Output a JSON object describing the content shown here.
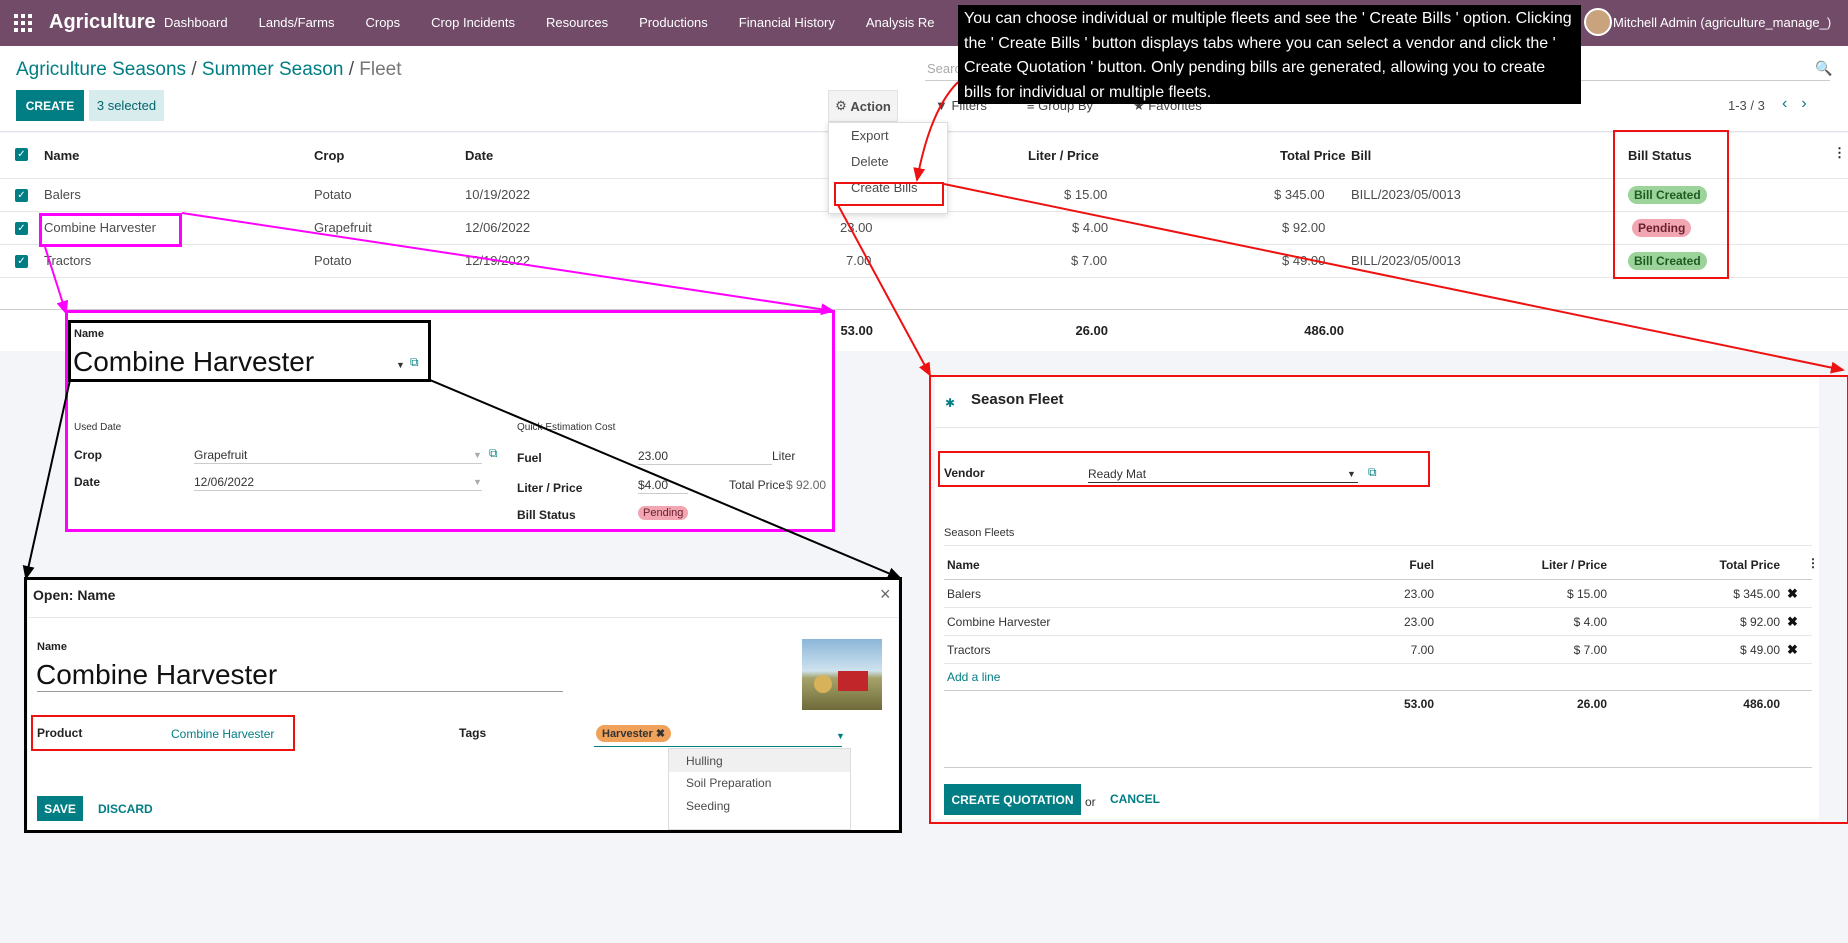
{
  "nav": {
    "brand": "Agriculture",
    "menu": [
      "Dashboard",
      "Lands/Farms",
      "Crops",
      "Crop Incidents",
      "Resources",
      "Productions",
      "Financial History",
      "Analysis Re"
    ],
    "user": "Mitchell Admin (agriculture_manage_)"
  },
  "breadcrumb": {
    "a": "Agriculture Seasons",
    "b": "Summer Season",
    "c": "Fleet",
    "sep": "/"
  },
  "controls": {
    "create": "CREATE",
    "selected": "3 selected",
    "action": "Action",
    "search_placeholder": "Search",
    "filters": "Filters",
    "groupby": "Group By",
    "favorites": "Favorites",
    "pager": "1-3 / 3"
  },
  "action_menu": [
    "Export",
    "Delete",
    "Create Bills"
  ],
  "tooltip": "You can choose individual or multiple fleets and see the ' Create Bills ' option. Clicking the ' Create Bills ' button displays tabs where you can select a vendor and click the ' Create Quotation ' button. Only pending bills are generated, allowing you to create bills for individual or multiple fleets.",
  "table": {
    "headers": {
      "name": "Name",
      "crop": "Crop",
      "date": "Date",
      "liter_price": "Liter / Price",
      "total": "Total Price",
      "bill": "Bill",
      "status": "Bill Status"
    },
    "rows": [
      {
        "name": "Balers",
        "crop": "Potato",
        "date": "10/19/2022",
        "fuel": "",
        "liter": "$ 15.00",
        "total": "$ 345.00",
        "bill": "BILL/2023/05/0013",
        "status": "Bill Created"
      },
      {
        "name": "Combine Harvester",
        "crop": "Grapefruit",
        "date": "12/06/2022",
        "fuel": "23.00",
        "liter": "$ 4.00",
        "total": "$ 92.00",
        "bill": "",
        "status": "Pending"
      },
      {
        "name": "Tractors",
        "crop": "Potato",
        "date": "12/19/2022",
        "fuel": "7.00",
        "liter": "$ 7.00",
        "total": "$ 49.00",
        "bill": "BILL/2023/05/0013",
        "status": "Bill Created"
      }
    ],
    "totals": {
      "fuel": "53.00",
      "liter": "26.00",
      "total": "486.00"
    }
  },
  "fleet_form": {
    "name_label": "Name",
    "name": "Combine Harvester",
    "used_date": "Used Date",
    "quick_cost": "Quick Estimation Cost",
    "crop_label": "Crop",
    "crop": "Grapefruit",
    "date_label": "Date",
    "date": "12/06/2022",
    "fuel_label": "Fuel",
    "fuel": "23.00",
    "fuel_unit": "Liter",
    "liter_label": "Liter / Price",
    "liter": "$4.00",
    "total_label": "Total Price",
    "total": "$ 92.00",
    "status_label": "Bill Status",
    "status": "Pending"
  },
  "open_dialog": {
    "title": "Open: Name",
    "close": "×",
    "name_label": "Name",
    "name": "Combine Harvester",
    "product_label": "Product",
    "product": "Combine Harvester",
    "tags_label": "Tags",
    "tag": "Harvester",
    "options": [
      "Hulling",
      "Soil Preparation",
      "Seeding"
    ],
    "save": "SAVE",
    "discard": "DISCARD"
  },
  "season_fleet": {
    "title": "Season Fleet",
    "vendor_label": "Vendor",
    "vendor": "Ready Mat",
    "section": "Season Fleets",
    "headers": {
      "name": "Name",
      "fuel": "Fuel",
      "liter": "Liter / Price",
      "total": "Total Price"
    },
    "rows": [
      {
        "name": "Balers",
        "fuel": "23.00",
        "liter": "$ 15.00",
        "total": "$ 345.00"
      },
      {
        "name": "Combine Harvester",
        "fuel": "23.00",
        "liter": "$ 4.00",
        "total": "$ 92.00"
      },
      {
        "name": "Tractors",
        "fuel": "7.00",
        "liter": "$ 7.00",
        "total": "$ 49.00"
      }
    ],
    "add_line": "Add a line",
    "totals": {
      "fuel": "53.00",
      "liter": "26.00",
      "total": "486.00"
    },
    "create_quotation": "CREATE QUOTATION",
    "or": "or",
    "cancel": "CANCEL"
  },
  "colors": {
    "nav": "#714b67",
    "primary": "#017e84",
    "callout_red": "#e11111",
    "callout_magenta": "#ff00ff"
  }
}
